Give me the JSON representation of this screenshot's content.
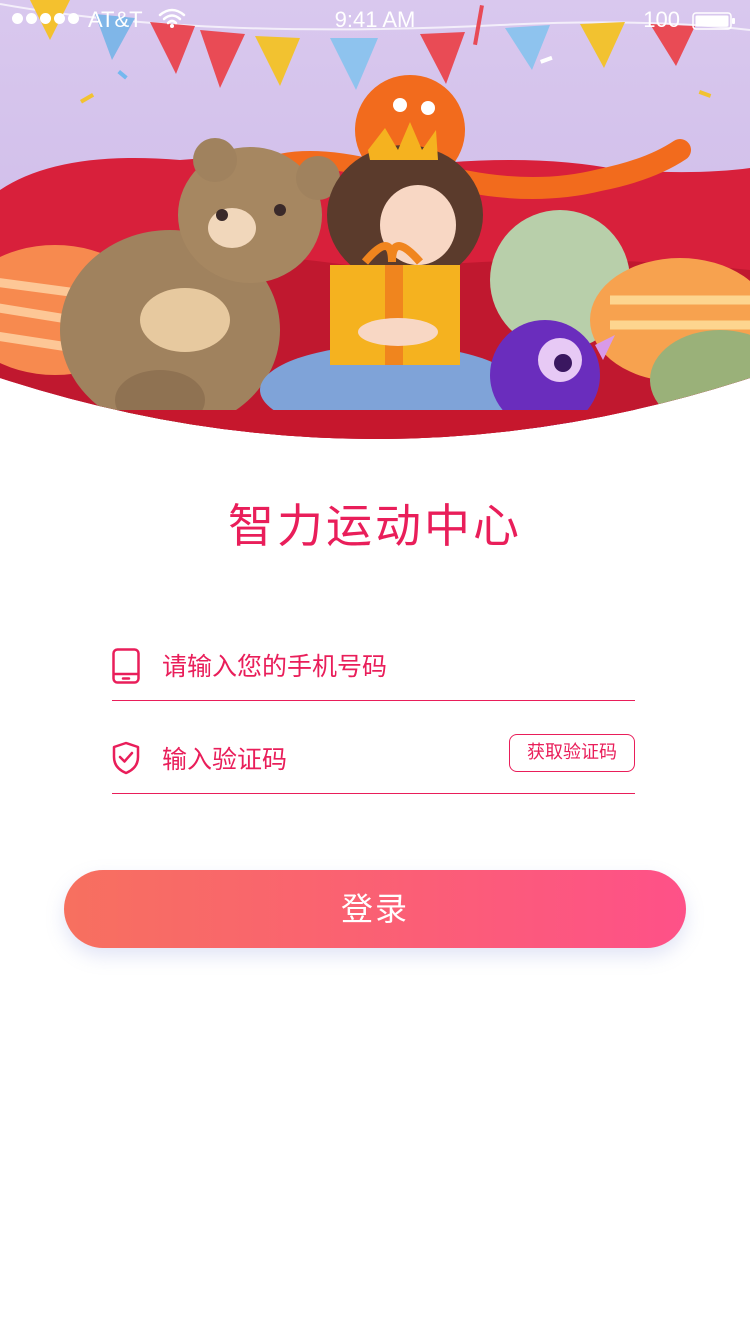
{
  "status_bar": {
    "carrier": "AT&T",
    "time": "9:41 AM",
    "battery": "100"
  },
  "hero": {
    "illustration": "party-illustration-girl-teddy-bear-gift"
  },
  "app": {
    "title": "智力运动中心"
  },
  "form": {
    "phone": {
      "placeholder": "请输入您的手机号码",
      "value": "",
      "icon": "phone-icon"
    },
    "code": {
      "placeholder": "输入验证码",
      "value": "",
      "icon": "shield-check-icon",
      "get_code_label": "获取验证码"
    }
  },
  "login_button": {
    "label": "登录"
  },
  "colors": {
    "accent": "#e91e5a",
    "button_start": "#f7705f",
    "button_end": "#fe5188"
  }
}
